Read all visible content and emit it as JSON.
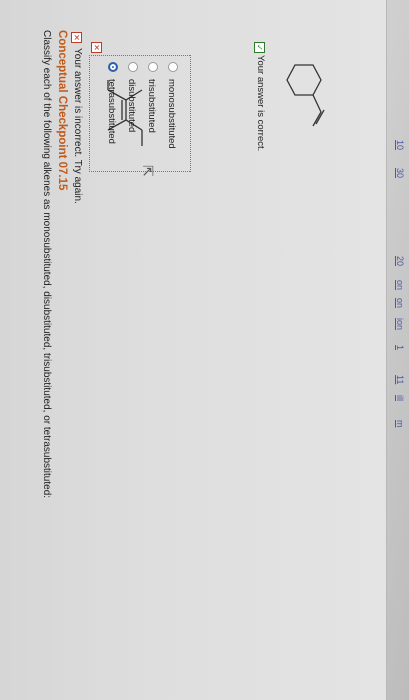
{
  "header": {
    "title": "Conceptual Checkpoint 07.15",
    "instructions": "Classify each of the following alkenes as monosubstituted, disubstituted, trisubstituted, or tetrasubstituted:"
  },
  "feedback": {
    "incorrect_text": "Your answer is incorrect.  Try again.",
    "correct_text": "Your answer is correct."
  },
  "options": [
    {
      "label": "tetrasubstituted",
      "selected": true
    },
    {
      "label": "disubstituted",
      "selected": false
    },
    {
      "label": "trisubstituted",
      "selected": false
    },
    {
      "label": "monosubstituted",
      "selected": false
    }
  ],
  "sidebar": {
    "items": [
      "10",
      "30",
      "20",
      "on",
      "on",
      "ion",
      "1",
      "11",
      "ill",
      "m"
    ]
  },
  "icons": {
    "incorrect": "x-icon",
    "correct": "check-icon",
    "cursor": "pointer-icon"
  },
  "colors": {
    "title": "#c25a1a",
    "link": "#4a58a8",
    "error": "#c0392b",
    "success": "#2c7a2c",
    "radio_selected": "#2a5fb0"
  }
}
